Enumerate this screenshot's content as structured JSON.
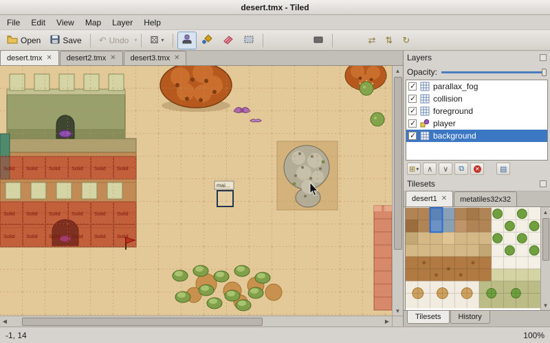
{
  "window": {
    "title": "desert.tmx - Tiled"
  },
  "menubar": {
    "items": [
      "File",
      "Edit",
      "View",
      "Map",
      "Layer",
      "Help"
    ]
  },
  "toolbar": {
    "open_label": "Open",
    "save_label": "Save",
    "undo_label": "Undo"
  },
  "document_tabs": [
    "desert.tmx",
    "desert2.tmx",
    "desert3.tmx"
  ],
  "layers_panel": {
    "title": "Layers",
    "opacity_label": "Opacity:",
    "layers": [
      {
        "name": "parallax_fog",
        "checked": true,
        "type": "tile",
        "selected": false
      },
      {
        "name": "collision",
        "checked": true,
        "type": "tile",
        "selected": false
      },
      {
        "name": "foreground",
        "checked": true,
        "type": "tile",
        "selected": false
      },
      {
        "name": "player",
        "checked": true,
        "type": "object",
        "selected": false
      },
      {
        "name": "background",
        "checked": true,
        "type": "tile",
        "selected": true
      }
    ]
  },
  "tilesets_panel": {
    "title": "Tilesets",
    "tabs": [
      {
        "label": "desert1",
        "active": true
      },
      {
        "label": "metatiles32x32",
        "active": false
      }
    ]
  },
  "dock_tabs": [
    "Tilesets",
    "History"
  ],
  "statusbar": {
    "coordinates": "-1, 14",
    "zoom": "100%"
  },
  "map": {
    "solid_label": "Solid",
    "tile_tooltip": "mai..."
  }
}
